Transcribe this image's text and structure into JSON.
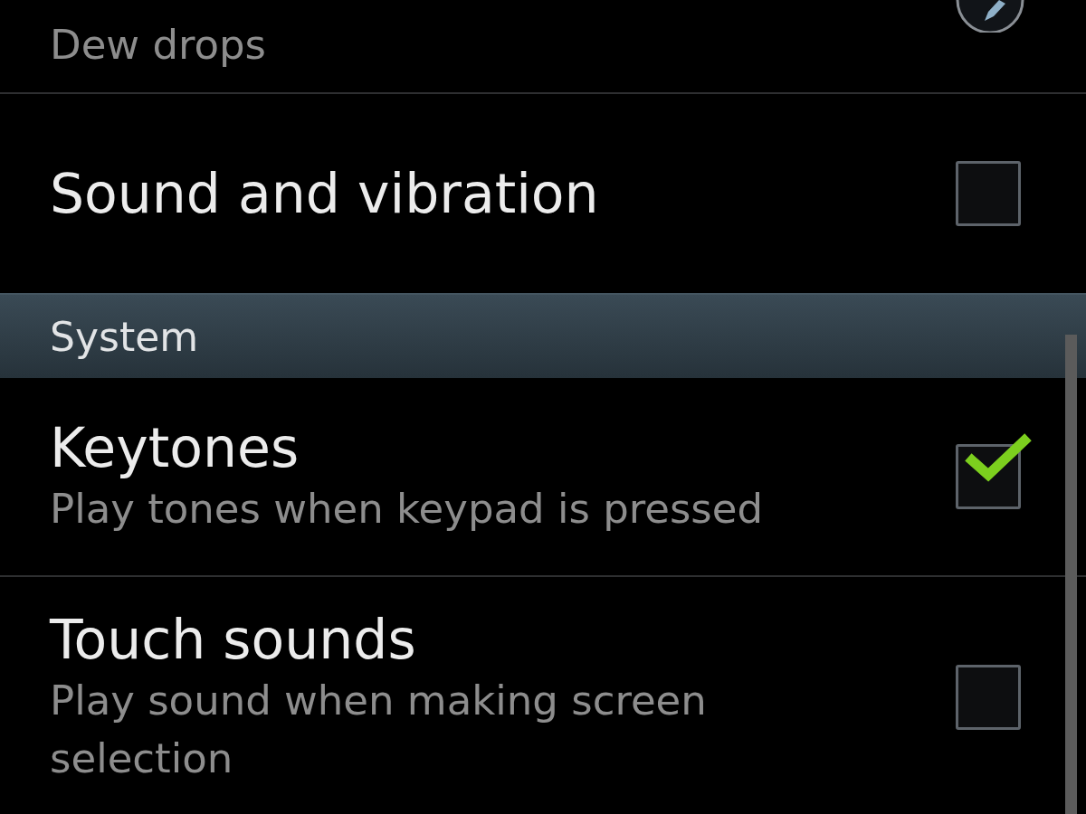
{
  "top_item": {
    "subtitle": "Dew drops"
  },
  "items_before": [
    {
      "title": "Sound and vibration",
      "checked": false
    }
  ],
  "section": {
    "title": "System"
  },
  "items": [
    {
      "title": "Keytones",
      "subtitle": "Play tones when keypad is pressed",
      "checked": true
    },
    {
      "title": "Touch sounds",
      "subtitle": "Play sound when making screen selection",
      "checked": false
    }
  ]
}
